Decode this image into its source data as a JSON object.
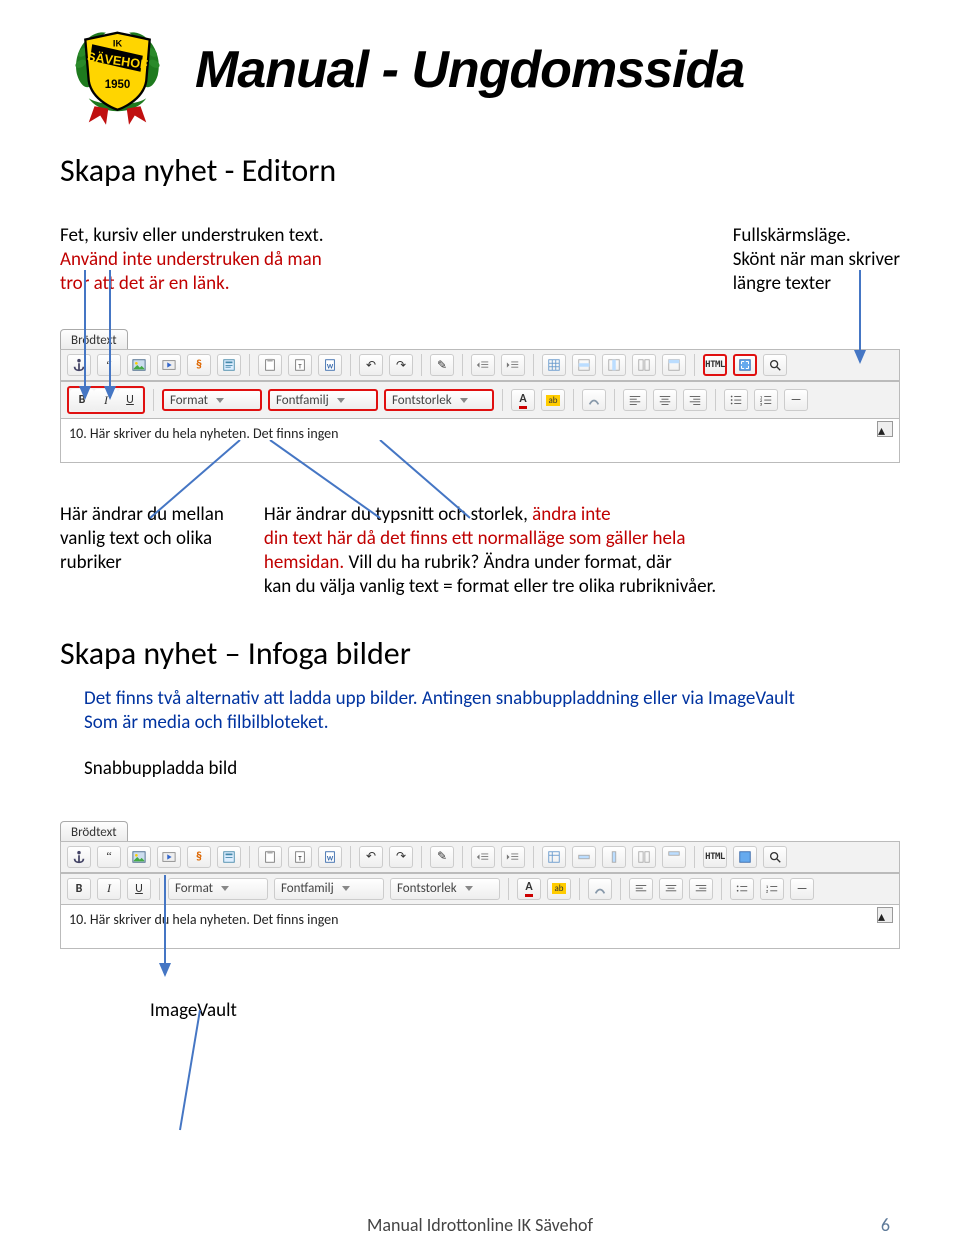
{
  "header": {
    "title": "Manual - Ungdomssida"
  },
  "section1": {
    "heading": "Skapa nyhet - Editorn",
    "left_annot_line1": "Fet, kursiv eller understruken text.",
    "left_annot_line2": "Använd inte understruken då man",
    "left_annot_line3": "tror att det är en länk.",
    "right_annot_line1": "Fullskärmsläge.",
    "right_annot_line2": "Skönt när man skriver",
    "right_annot_line3": "längre texter"
  },
  "toolbar": {
    "tab_label": "Brödtext",
    "format": "Format",
    "fontfamily": "Fontfamilj",
    "fontsize": "Fontstorlek",
    "bold": "B",
    "italic": "I",
    "underline": "U",
    "html": "HTML",
    "content_text": "10. Här skriver du hela nyheten. Det finns ingen"
  },
  "mid_annot": {
    "col1_l1": "Här ändrar du mellan",
    "col1_l2": "vanlig text och olika",
    "col1_l3": "rubriker",
    "col2_l1a": "Här ändrar du typsnitt och storlek, ",
    "col2_l1b": "ändra inte",
    "col2_l2a": "din text här då det finns ett normalläge som gäller hela",
    "col2_l3a": "hemsidan.",
    "col2_l3b": " Vill du ha rubrik? Ändra under format, där",
    "col2_l4": "kan du välja vanlig text = format eller tre olika rubriknivåer."
  },
  "section2": {
    "heading": "Skapa nyhet – Infoga bilder",
    "p1": "Det finns två alternativ att ladda upp bilder. Antingen snabbuppladdning eller via ImageVault",
    "p2": "Som är media och filbilbloteket.",
    "sub": "Snabbuppladda bild",
    "imagevault": "ImageVault"
  },
  "footer": {
    "text": "Manual Idrottonline IK Sävehof",
    "page": "6"
  }
}
